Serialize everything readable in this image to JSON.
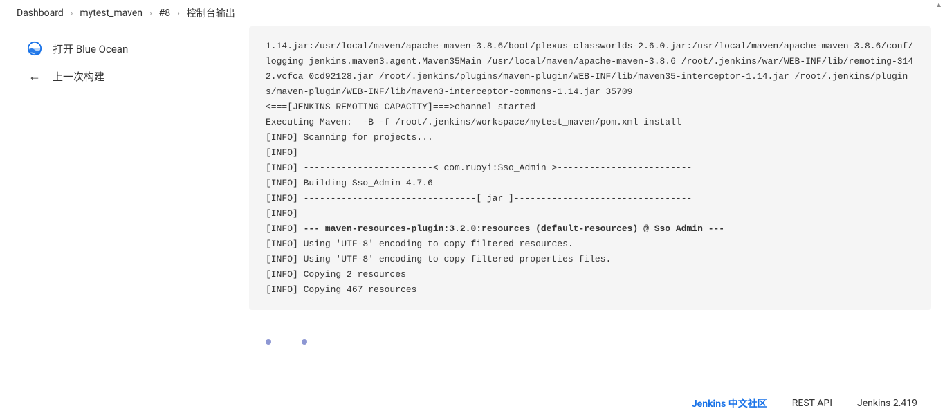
{
  "breadcrumb": {
    "items": [
      "Dashboard",
      "mytest_maven",
      "#8",
      "控制台输出"
    ]
  },
  "sidebar": {
    "blueocean_label": "打开 Blue Ocean",
    "prev_build_label": "上一次构建"
  },
  "console": {
    "lines": [
      {
        "text": "1.14.jar:/usr/local/maven/apache-maven-3.8.6/boot/plexus-classworlds-2.6.0.jar:/usr/local/maven/apache-maven-3.8.6/conf/logging jenkins.maven3.agent.Maven35Main /usr/local/maven/apache-maven-3.8.6 /root/.jenkins/war/WEB-INF/lib/remoting-3142.vcfca_0cd92128.jar /root/.jenkins/plugins/maven-plugin/WEB-INF/lib/maven35-interceptor-1.14.jar /root/.jenkins/plugins/maven-plugin/WEB-INF/lib/maven3-interceptor-commons-1.14.jar 35709"
      },
      {
        "text": "<===[JENKINS REMOTING CAPACITY]===>channel started"
      },
      {
        "text": "Executing Maven:  -B -f /root/.jenkins/workspace/mytest_maven/pom.xml install"
      },
      {
        "text": "[INFO] Scanning for projects..."
      },
      {
        "text": "[INFO] "
      },
      {
        "text": "[INFO] ------------------------< com.ruoyi:Sso_Admin >-------------------------"
      },
      {
        "text": "[INFO] Building Sso_Admin 4.7.6"
      },
      {
        "text": "[INFO] --------------------------------[ jar ]---------------------------------"
      },
      {
        "text": "[INFO] "
      },
      {
        "prefix": "[INFO] ",
        "bold": "--- maven-resources-plugin:3.2.0:resources (default-resources) @ Sso_Admin ---"
      },
      {
        "text": "[INFO] Using 'UTF-8' encoding to copy filtered resources."
      },
      {
        "text": "[INFO] Using 'UTF-8' encoding to copy filtered properties files."
      },
      {
        "text": "[INFO] Copying 2 resources"
      },
      {
        "text": "[INFO] Copying 467 resources"
      }
    ]
  },
  "footer": {
    "community_link": "Jenkins 中文社区",
    "rest_api": "REST API",
    "version": "Jenkins 2.419"
  }
}
